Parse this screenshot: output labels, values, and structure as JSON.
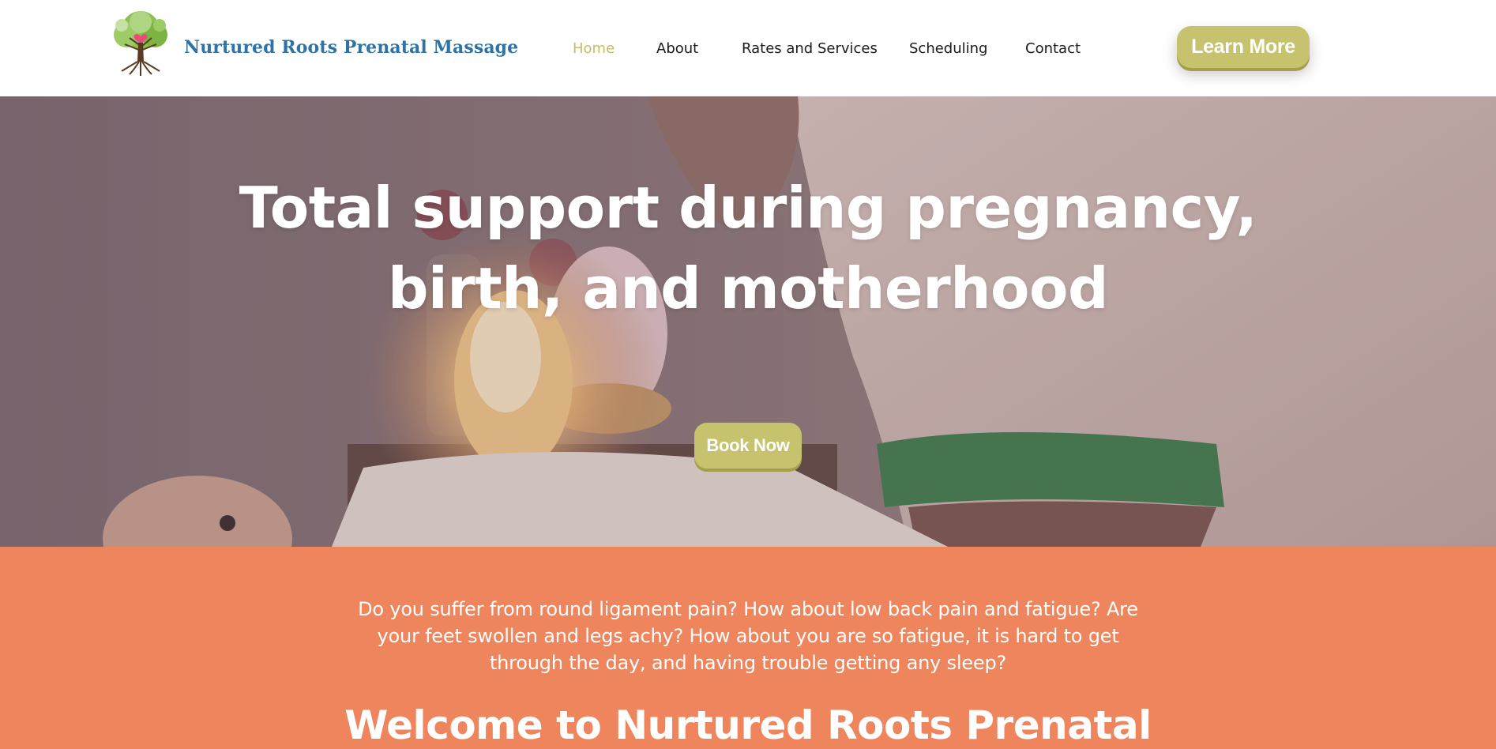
{
  "header": {
    "brand": "Nurtured Roots Prenatal Massage",
    "logo_icon": "tree-logo-icon",
    "nav": [
      {
        "label": "Home",
        "active": true
      },
      {
        "label": "About",
        "active": false
      },
      {
        "label": "Rates and Services",
        "active": false
      },
      {
        "label": "Scheduling",
        "active": false
      },
      {
        "label": "Contact",
        "active": false
      }
    ],
    "cta_label": "Learn More"
  },
  "hero": {
    "title": "Total support during pregnancy, birth, and motherhood",
    "cta_label": "Book Now"
  },
  "intro": {
    "text": "Do you suffer from round ligament pain? How about low back pain and fatigue? Are your feet swollen and legs achy? How about you are so fatigue, it is hard to get through the day, and having trouble getting any sleep?",
    "welcome": "Welcome to Nurtured Roots Prenatal"
  },
  "colors": {
    "accent": "#c6c26d",
    "brand_blue": "#2f73a6",
    "section_orange": "#ee855c",
    "nav_text": "#1b1b1b"
  }
}
